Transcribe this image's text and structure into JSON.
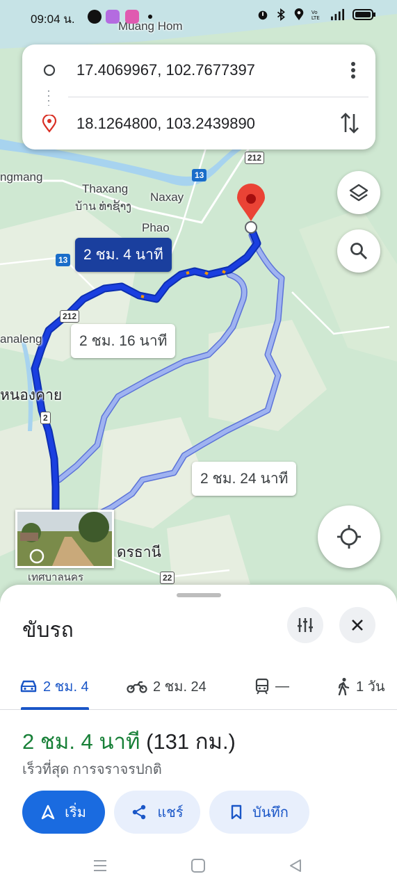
{
  "status_bar": {
    "time": "09:04 น.",
    "icons": [
      "line-icon",
      "messenger-icon",
      "app-icon",
      "dot-icon",
      "alarm-icon",
      "bluetooth-icon",
      "location-icon",
      "volte-icon",
      "signal-icon",
      "battery-icon"
    ]
  },
  "route_inputs": {
    "origin": "17.4069967, 102.7677397",
    "destination": "18.1264800, 103.2439890"
  },
  "map": {
    "labels": {
      "muang_hom": "Muang Hom",
      "gmang": "ngmang",
      "thaxang": "Thaxang",
      "thaxang_lao": "บ้าน ທ່າຊ້າງ",
      "naxay": "Naxay",
      "phao": "Phao",
      "analeng": "analeng",
      "nong_khai": "หนองคาย",
      "udon": "ดรธานี",
      "udon_sub": "เทศบาลนคร"
    },
    "shields": {
      "r13a": "13",
      "r13b": "13",
      "r212a": "212",
      "r212b": "212",
      "r2": "2",
      "r22": "22"
    },
    "routes": {
      "primary": "2 ชม. 4 นาที",
      "alt1": "2 ชม. 16 นาที",
      "alt2": "2 ชม. 24 นาที"
    },
    "colors": {
      "primary_route": "#1a3fe0",
      "alt_route": "#9fb3f0",
      "pin": "#ea4335",
      "land": "#cfe8d2",
      "water": "#a7d3ef"
    }
  },
  "sheet": {
    "title": "ขับรถ",
    "modes": [
      {
        "icon": "car-icon",
        "label": "2 ชม. 4"
      },
      {
        "icon": "motorbike-icon",
        "label": "2 ชม. 24"
      },
      {
        "icon": "transit-icon",
        "label": "—"
      },
      {
        "icon": "walk-icon",
        "label": "1 วัน"
      }
    ],
    "duration": "2 ชม. 4 นาที",
    "distance": "(131 กม.)",
    "note": "เร็วที่สุด การจราจรปกติ",
    "buttons": {
      "start": "เริ่ม",
      "share": "แชร์",
      "save": "บันทึก"
    }
  }
}
